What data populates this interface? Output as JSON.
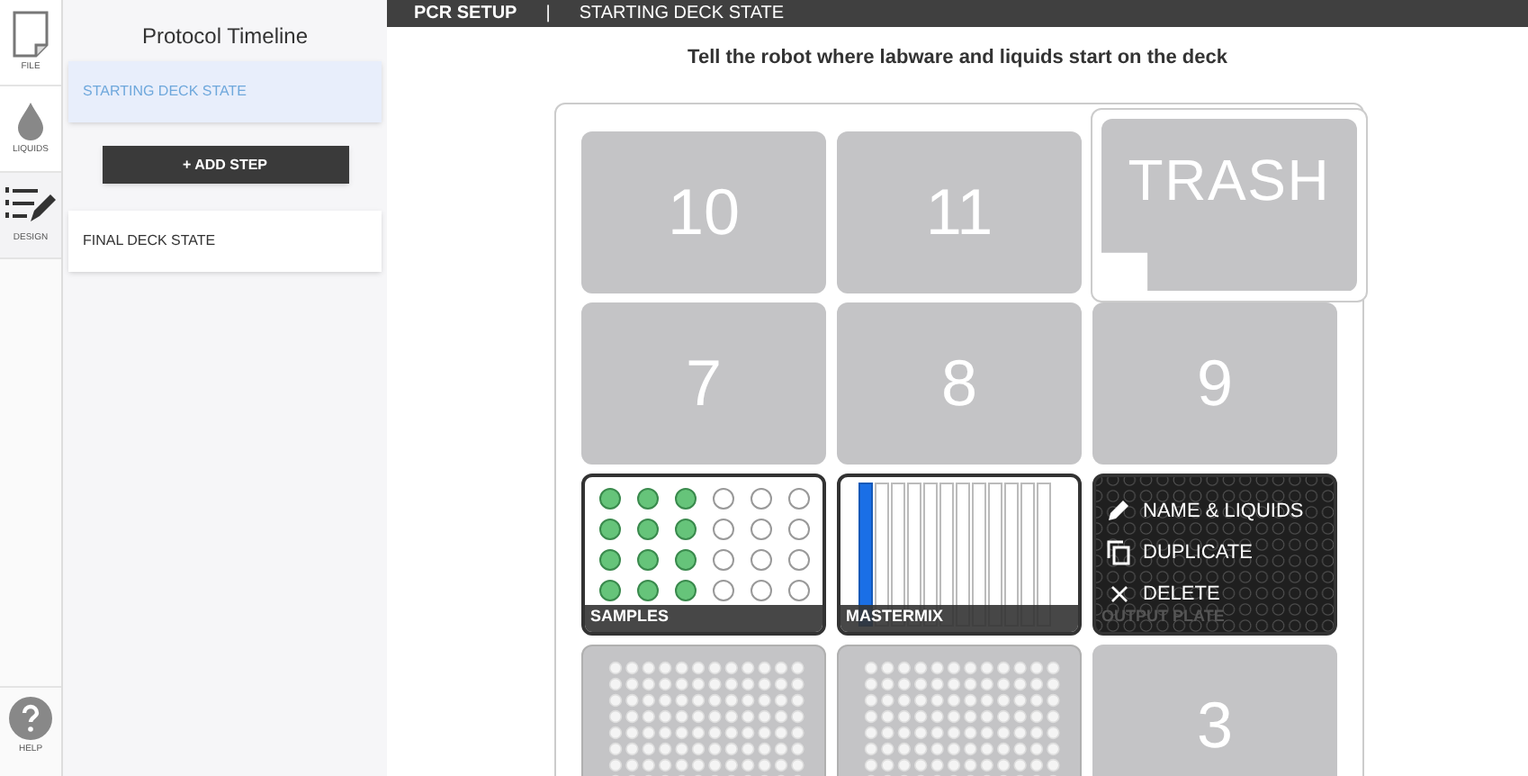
{
  "nav": [
    {
      "kind": "file",
      "label": "FILE",
      "selected": false
    },
    {
      "kind": "liquids",
      "label": "LIQUIDS",
      "selected": false
    },
    {
      "kind": "design",
      "label": "DESIGN",
      "selected": true
    }
  ],
  "help": {
    "label": "HELP"
  },
  "sidebar": {
    "title": "Protocol Timeline",
    "add_step": "+ ADD STEP",
    "steps": [
      {
        "label": "STARTING DECK STATE",
        "selected": true
      },
      {
        "label": "FINAL DECK STATE",
        "selected": false
      }
    ]
  },
  "header": {
    "title": "PCR SETUP",
    "separator": "|",
    "subtitle": "STARTING DECK STATE"
  },
  "instruction": "Tell the robot where labware and liquids start on the deck",
  "slots": [
    {
      "kind": "number",
      "label": "10"
    },
    {
      "kind": "number",
      "label": "11"
    },
    {
      "kind": "trash",
      "label": "TRASH"
    },
    {
      "kind": "number",
      "label": "7"
    },
    {
      "kind": "number",
      "label": "8"
    },
    {
      "kind": "number",
      "label": "9"
    },
    {
      "kind": "tubes",
      "name": "SAMPLES",
      "wells": [
        [
          true,
          true,
          true,
          false,
          false,
          false
        ],
        [
          true,
          true,
          true,
          false,
          false,
          false
        ],
        [
          true,
          true,
          true,
          false,
          false,
          false
        ],
        [
          true,
          true,
          true,
          false,
          false,
          false
        ]
      ]
    },
    {
      "kind": "trough",
      "name": "MASTERMIX",
      "channels": [
        true,
        false,
        false,
        false,
        false,
        false,
        false,
        false,
        false,
        false,
        false,
        false
      ]
    },
    {
      "kind": "plate",
      "name": "OUTPUT PLATE",
      "menu": [
        {
          "kind": "edit",
          "label": "NAME & LIQUIDS"
        },
        {
          "kind": "duplicate",
          "label": "DUPLICATE"
        },
        {
          "kind": "delete",
          "label": "DELETE"
        }
      ]
    },
    {
      "kind": "empty_plate"
    },
    {
      "kind": "empty_plate"
    },
    {
      "kind": "number",
      "label": "3"
    }
  ]
}
